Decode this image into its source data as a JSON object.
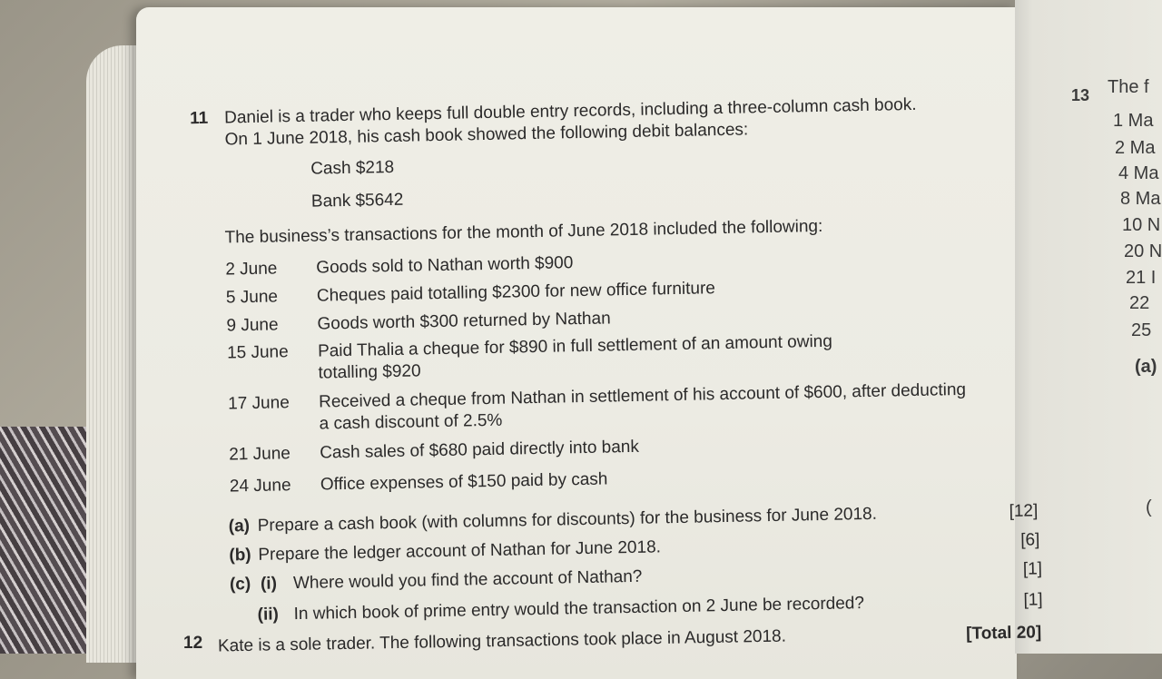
{
  "q11": {
    "number": "11",
    "intro_line1": "Daniel is a trader who keeps full double entry records, including a three-column cash book.",
    "intro_line2": "On 1 June 2018, his cash book showed the following debit balances:",
    "balance_cash": "Cash $218",
    "balance_bank": "Bank $5642",
    "transactions_intro": "The business’s transactions for the month of June 2018 included the following:",
    "transactions": [
      {
        "date": "2 June",
        "line1": "Goods sold to Nathan worth $900",
        "line2": ""
      },
      {
        "date": "5 June",
        "line1": "Cheques paid totalling $2300 for new office furniture",
        "line2": ""
      },
      {
        "date": "9 June",
        "line1": "Goods worth $300 returned by Nathan",
        "line2": ""
      },
      {
        "date": "15 June",
        "line1": "Paid Thalia a cheque for $890 in full settlement of an amount owing",
        "line2": "totalling $920"
      },
      {
        "date": "17 June",
        "line1": "Received a cheque from Nathan in settlement of his account of $600, after deducting",
        "line2": "a cash discount of 2.5%"
      },
      {
        "date": "21 June",
        "line1": "Cash sales of $680 paid directly into bank",
        "line2": ""
      },
      {
        "date": "24 June",
        "line1": "Office expenses of $150 paid by cash",
        "line2": ""
      }
    ],
    "parts": [
      {
        "label": "(a)",
        "sub": "",
        "text": "Prepare a cash book (with columns for discounts) for the business for June 2018.",
        "marks": "[12]"
      },
      {
        "label": "(b)",
        "sub": "",
        "text": "Prepare the ledger account of Nathan for June 2018.",
        "marks": "[6]"
      },
      {
        "label": "(c)",
        "sub": "(i)",
        "text": "Where would you find the account of Nathan?",
        "marks": "[1]"
      },
      {
        "label": "",
        "sub": "(ii)",
        "text": "In which book of prime entry would the transaction on 2 June be recorded?",
        "marks": "[1]"
      }
    ],
    "total": "[Total 20]"
  },
  "q12": {
    "number": "12",
    "text": "Kate is a sole trader. The following transactions took place in August 2018."
  },
  "right_page": {
    "number": "13",
    "header": "The f",
    "dates": [
      "1 Ma",
      "2 Ma",
      "4 Ma",
      "8 Ma",
      "10 N",
      "20 N",
      "21 I",
      "22",
      "25"
    ],
    "part_a": "(a)",
    "part_paren": "("
  }
}
